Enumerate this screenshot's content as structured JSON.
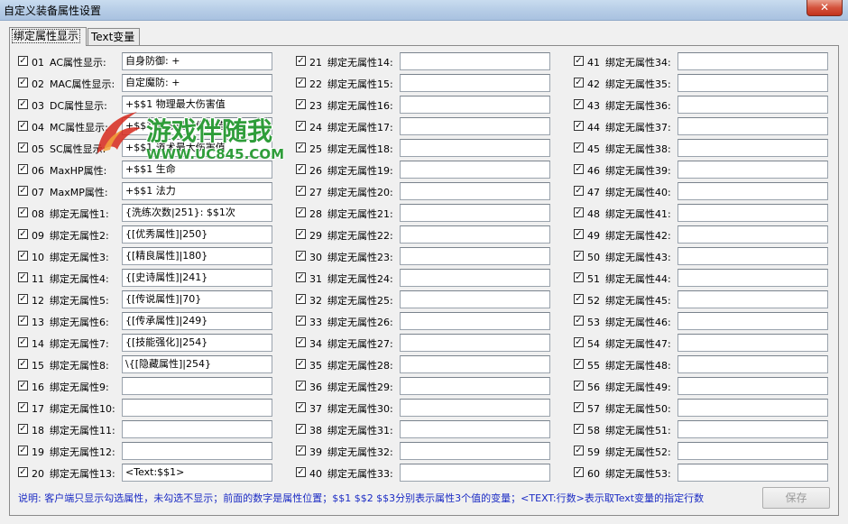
{
  "window": {
    "title": "自定义装备属性设置",
    "close_glyph": "✕"
  },
  "tabs": [
    {
      "label": "绑定属性显示",
      "active": true
    },
    {
      "label": "Text变量",
      "active": false
    }
  ],
  "rows": [
    {
      "num": "01",
      "label": "AC属性显示:",
      "value": "自身防御: +",
      "checked": true
    },
    {
      "num": "02",
      "label": "MAC属性显示:",
      "value": "自定魔防: +",
      "checked": true
    },
    {
      "num": "03",
      "label": "DC属性显示:",
      "value": "+$$1 物理最大伤害值",
      "checked": true
    },
    {
      "num": "04",
      "label": "MC属性显示:",
      "value": "+$$1 魔法最大伤害值",
      "checked": true
    },
    {
      "num": "05",
      "label": "SC属性显示:",
      "value": "+$$1 道术最大伤害值",
      "checked": true
    },
    {
      "num": "06",
      "label": "MaxHP属性:",
      "value": "+$$1 生命",
      "checked": true
    },
    {
      "num": "07",
      "label": "MaxMP属性:",
      "value": "+$$1 法力",
      "checked": true
    },
    {
      "num": "08",
      "label": "绑定无属性1:",
      "value": "{洗练次数|251}: $$1次",
      "checked": true
    },
    {
      "num": "09",
      "label": "绑定无属性2:",
      "value": "{[优秀属性]|250}",
      "checked": true
    },
    {
      "num": "10",
      "label": "绑定无属性3:",
      "value": "{[精良属性]|180}",
      "checked": true
    },
    {
      "num": "11",
      "label": "绑定无属性4:",
      "value": "{[史诗属性]|241}",
      "checked": true
    },
    {
      "num": "12",
      "label": "绑定无属性5:",
      "value": "{[传说属性]|70}",
      "checked": true
    },
    {
      "num": "13",
      "label": "绑定无属性6:",
      "value": "{[传承属性]|249}",
      "checked": true
    },
    {
      "num": "14",
      "label": "绑定无属性7:",
      "value": "{[技能强化]|254}",
      "checked": true
    },
    {
      "num": "15",
      "label": "绑定无属性8:",
      "value": "  \\{[隐藏属性]|254}",
      "checked": true
    },
    {
      "num": "16",
      "label": "绑定无属性9:",
      "value": "",
      "checked": true
    },
    {
      "num": "17",
      "label": "绑定无属性10:",
      "value": "",
      "checked": true
    },
    {
      "num": "18",
      "label": "绑定无属性11:",
      "value": "",
      "checked": true
    },
    {
      "num": "19",
      "label": "绑定无属性12:",
      "value": "",
      "checked": true
    },
    {
      "num": "20",
      "label": "绑定无属性13:",
      "value": "<Text:$$1>",
      "checked": true
    },
    {
      "num": "21",
      "label": "绑定无属性14:",
      "value": "",
      "checked": true
    },
    {
      "num": "22",
      "label": "绑定无属性15:",
      "value": "",
      "checked": true
    },
    {
      "num": "23",
      "label": "绑定无属性16:",
      "value": "",
      "checked": true
    },
    {
      "num": "24",
      "label": "绑定无属性17:",
      "value": "",
      "checked": true
    },
    {
      "num": "25",
      "label": "绑定无属性18:",
      "value": "",
      "checked": true
    },
    {
      "num": "26",
      "label": "绑定无属性19:",
      "value": "",
      "checked": true
    },
    {
      "num": "27",
      "label": "绑定无属性20:",
      "value": "",
      "checked": true
    },
    {
      "num": "28",
      "label": "绑定无属性21:",
      "value": "",
      "checked": true
    },
    {
      "num": "29",
      "label": "绑定无属性22:",
      "value": "",
      "checked": true
    },
    {
      "num": "30",
      "label": "绑定无属性23:",
      "value": "",
      "checked": true
    },
    {
      "num": "31",
      "label": "绑定无属性24:",
      "value": "",
      "checked": true
    },
    {
      "num": "32",
      "label": "绑定无属性25:",
      "value": "",
      "checked": true
    },
    {
      "num": "33",
      "label": "绑定无属性26:",
      "value": "",
      "checked": true
    },
    {
      "num": "34",
      "label": "绑定无属性27:",
      "value": "",
      "checked": true
    },
    {
      "num": "35",
      "label": "绑定无属性28:",
      "value": "",
      "checked": true
    },
    {
      "num": "36",
      "label": "绑定无属性29:",
      "value": "",
      "checked": true
    },
    {
      "num": "37",
      "label": "绑定无属性30:",
      "value": "",
      "checked": true
    },
    {
      "num": "38",
      "label": "绑定无属性31:",
      "value": "",
      "checked": true
    },
    {
      "num": "39",
      "label": "绑定无属性32:",
      "value": "",
      "checked": true
    },
    {
      "num": "40",
      "label": "绑定无属性33:",
      "value": "",
      "checked": true
    },
    {
      "num": "41",
      "label": "绑定无属性34:",
      "value": "",
      "checked": true
    },
    {
      "num": "42",
      "label": "绑定无属性35:",
      "value": "",
      "checked": true
    },
    {
      "num": "43",
      "label": "绑定无属性36:",
      "value": "",
      "checked": true
    },
    {
      "num": "44",
      "label": "绑定无属性37:",
      "value": "",
      "checked": true
    },
    {
      "num": "45",
      "label": "绑定无属性38:",
      "value": "",
      "checked": true
    },
    {
      "num": "46",
      "label": "绑定无属性39:",
      "value": "",
      "checked": true
    },
    {
      "num": "47",
      "label": "绑定无属性40:",
      "value": "",
      "checked": true
    },
    {
      "num": "48",
      "label": "绑定无属性41:",
      "value": "",
      "checked": true
    },
    {
      "num": "49",
      "label": "绑定无属性42:",
      "value": "",
      "checked": true
    },
    {
      "num": "50",
      "label": "绑定无属性43:",
      "value": "",
      "checked": true
    },
    {
      "num": "51",
      "label": "绑定无属性44:",
      "value": "",
      "checked": true
    },
    {
      "num": "52",
      "label": "绑定无属性45:",
      "value": "",
      "checked": true
    },
    {
      "num": "53",
      "label": "绑定无属性46:",
      "value": "",
      "checked": true
    },
    {
      "num": "54",
      "label": "绑定无属性47:",
      "value": "",
      "checked": true
    },
    {
      "num": "55",
      "label": "绑定无属性48:",
      "value": "",
      "checked": true
    },
    {
      "num": "56",
      "label": "绑定无属性49:",
      "value": "",
      "checked": true
    },
    {
      "num": "57",
      "label": "绑定无属性50:",
      "value": "",
      "checked": true
    },
    {
      "num": "58",
      "label": "绑定无属性51:",
      "value": "",
      "checked": true
    },
    {
      "num": "59",
      "label": "绑定无属性52:",
      "value": "",
      "checked": true
    },
    {
      "num": "60",
      "label": "绑定无属性53:",
      "value": "",
      "checked": true
    }
  ],
  "footer": {
    "note": "说明: 客户端只显示勾选属性，未勾选不显示；前面的数字是属性位置；$$1 $$2 $$3分别表示属性3个值的变量；<TEXT:行数>表示取Text变量的指定行数",
    "save_label": "保存",
    "save_enabled": false
  },
  "watermark": {
    "text": "游戏伴随我",
    "url": "WWW.UC845.COM"
  },
  "colors": {
    "note_text": "#1b2bc4",
    "titlebar": "#b5cce6",
    "close_button": "#d4533d",
    "watermark": "#2f9d3a"
  }
}
